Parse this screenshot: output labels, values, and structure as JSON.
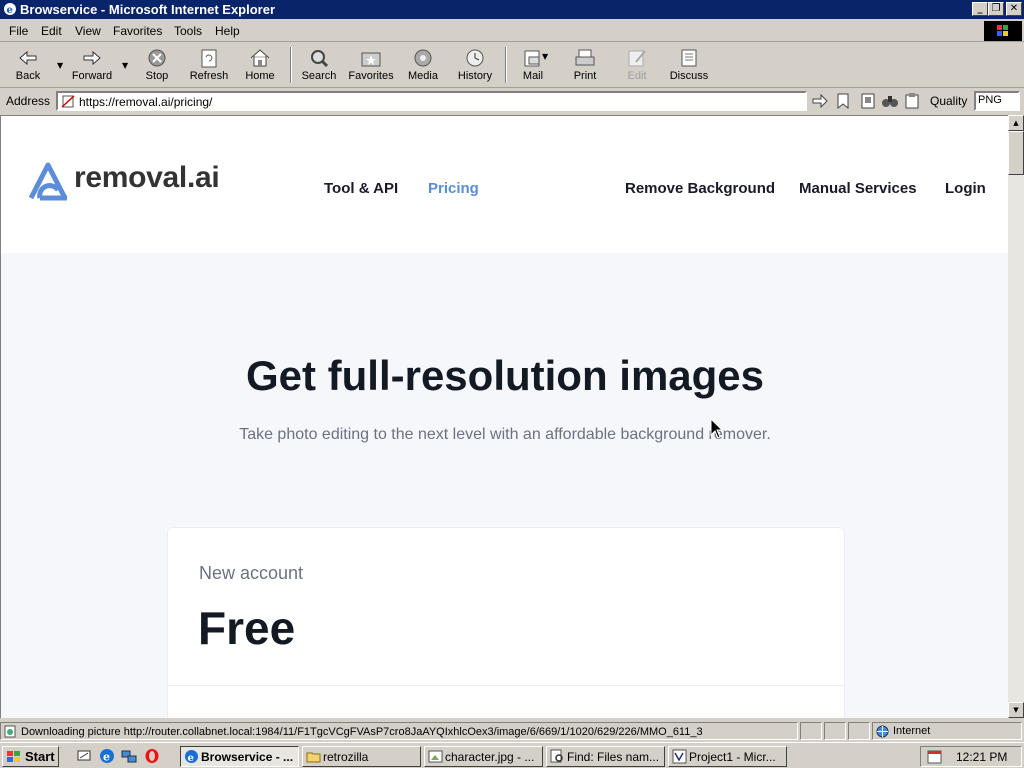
{
  "window": {
    "title": "Browservice - Microsoft Internet Explorer",
    "controls": [
      "_",
      "❐",
      "✕"
    ]
  },
  "menu": [
    "File",
    "Edit",
    "View",
    "Favorites",
    "Tools",
    "Help"
  ],
  "toolbar": {
    "back": "Back",
    "forward": "Forward",
    "stop": "Stop",
    "refresh": "Refresh",
    "home": "Home",
    "search": "Search",
    "favorites": "Favorites",
    "media": "Media",
    "history": "History",
    "mail": "Mail",
    "print": "Print",
    "edit": "Edit",
    "discuss": "Discuss"
  },
  "address": {
    "label": "Address",
    "url": "https://removal.ai/pricing/",
    "quality_label": "Quality",
    "quality_value": "PNG"
  },
  "site": {
    "logo_text": "removal.ai",
    "nav": {
      "tool_api": "Tool & API",
      "pricing": "Pricing",
      "remove_background": "Remove Background",
      "manual_services": "Manual Services",
      "login": "Login"
    },
    "accent_color": "#5b8dd9",
    "hero": {
      "title": "Get full-resolution images",
      "subtitle": "Take photo editing to the next level with an affordable background remover."
    },
    "plan": {
      "label": "New account",
      "name": "Free"
    }
  },
  "status": {
    "text": "Downloading picture http://router.collabnet.local:1984/11/F1TgcVCgFVAsP7cro8JaAYQIxhlcOex3/image/6/669/1/1020/629/226/MMO_611_3",
    "zone": "Internet"
  },
  "taskbar": {
    "start": "Start",
    "tasks": [
      "Browservice - ...",
      "retrozilla",
      "character.jpg - ...",
      "Find: Files nam...",
      "Project1 - Micr..."
    ],
    "clock": "12:21 PM"
  }
}
